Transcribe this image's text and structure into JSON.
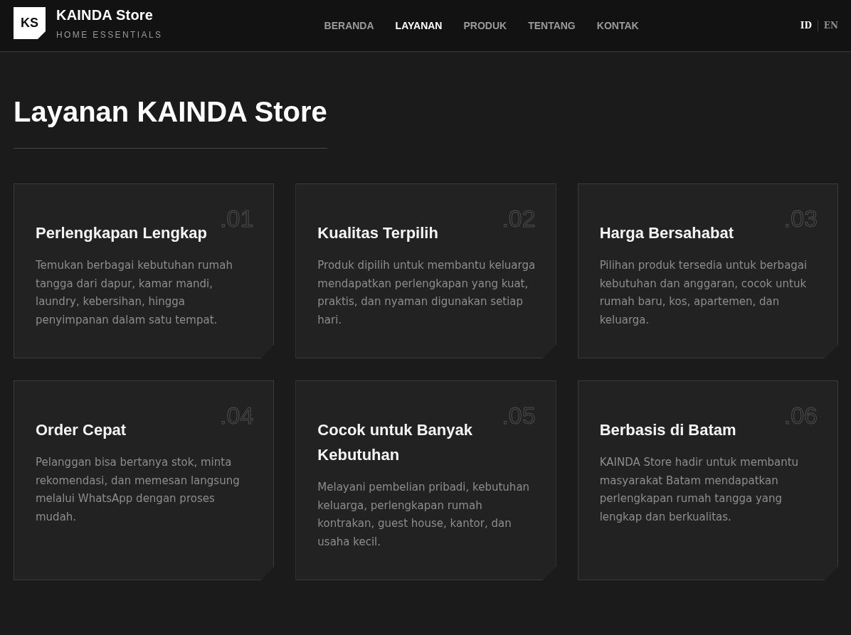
{
  "header": {
    "logo": {
      "mark": "KS",
      "name": "KAINDA Store",
      "tagline": "HOME ESSENTIALS"
    },
    "nav": [
      {
        "label": "BERANDA",
        "selected": false
      },
      {
        "label": "LAYANAN",
        "selected": true
      },
      {
        "label": "PRODUK",
        "selected": false
      },
      {
        "label": "TENTANG",
        "selected": false
      },
      {
        "label": "KONTAK",
        "selected": false
      }
    ],
    "languages": [
      {
        "label": "ID",
        "selected": true
      },
      {
        "label": "EN",
        "selected": false
      }
    ]
  },
  "page": {
    "title": "Layanan KAINDA Store"
  },
  "services": [
    {
      "number": ".01",
      "title": "Perlengkapan Lengkap",
      "description": "Temukan berbagai kebutuhan rumah tangga dari dapur, kamar mandi, laundry, kebersihan, hingga penyimpanan dalam satu tempat."
    },
    {
      "number": ".02",
      "title": "Kualitas Terpilih",
      "description": "Produk dipilih untuk membantu keluarga mendapatkan perlengkapan yang kuat, praktis, dan nyaman digunakan setiap hari."
    },
    {
      "number": ".03",
      "title": "Harga Bersahabat",
      "description": "Pilihan produk tersedia untuk berbagai kebutuhan dan anggaran, cocok untuk rumah baru, kos, apartemen, dan keluarga."
    },
    {
      "number": ".04",
      "title": "Order Cepat",
      "description": "Pelanggan bisa bertanya stok, minta rekomendasi, dan memesan langsung melalui WhatsApp dengan proses mudah."
    },
    {
      "number": ".05",
      "title": "Cocok untuk Banyak Kebutuhan",
      "description": "Melayani pembelian pribadi, kebutuhan keluarga, perlengkapan rumah kontrakan, guest house, kantor, dan usaha kecil."
    },
    {
      "number": ".06",
      "title": "Berbasis di Batam",
      "description": "KAINDA Store hadir untuk membantu masyarakat Batam mendapatkan perlengkapan rumah tangga yang lengkap dan berkualitas."
    }
  ]
}
